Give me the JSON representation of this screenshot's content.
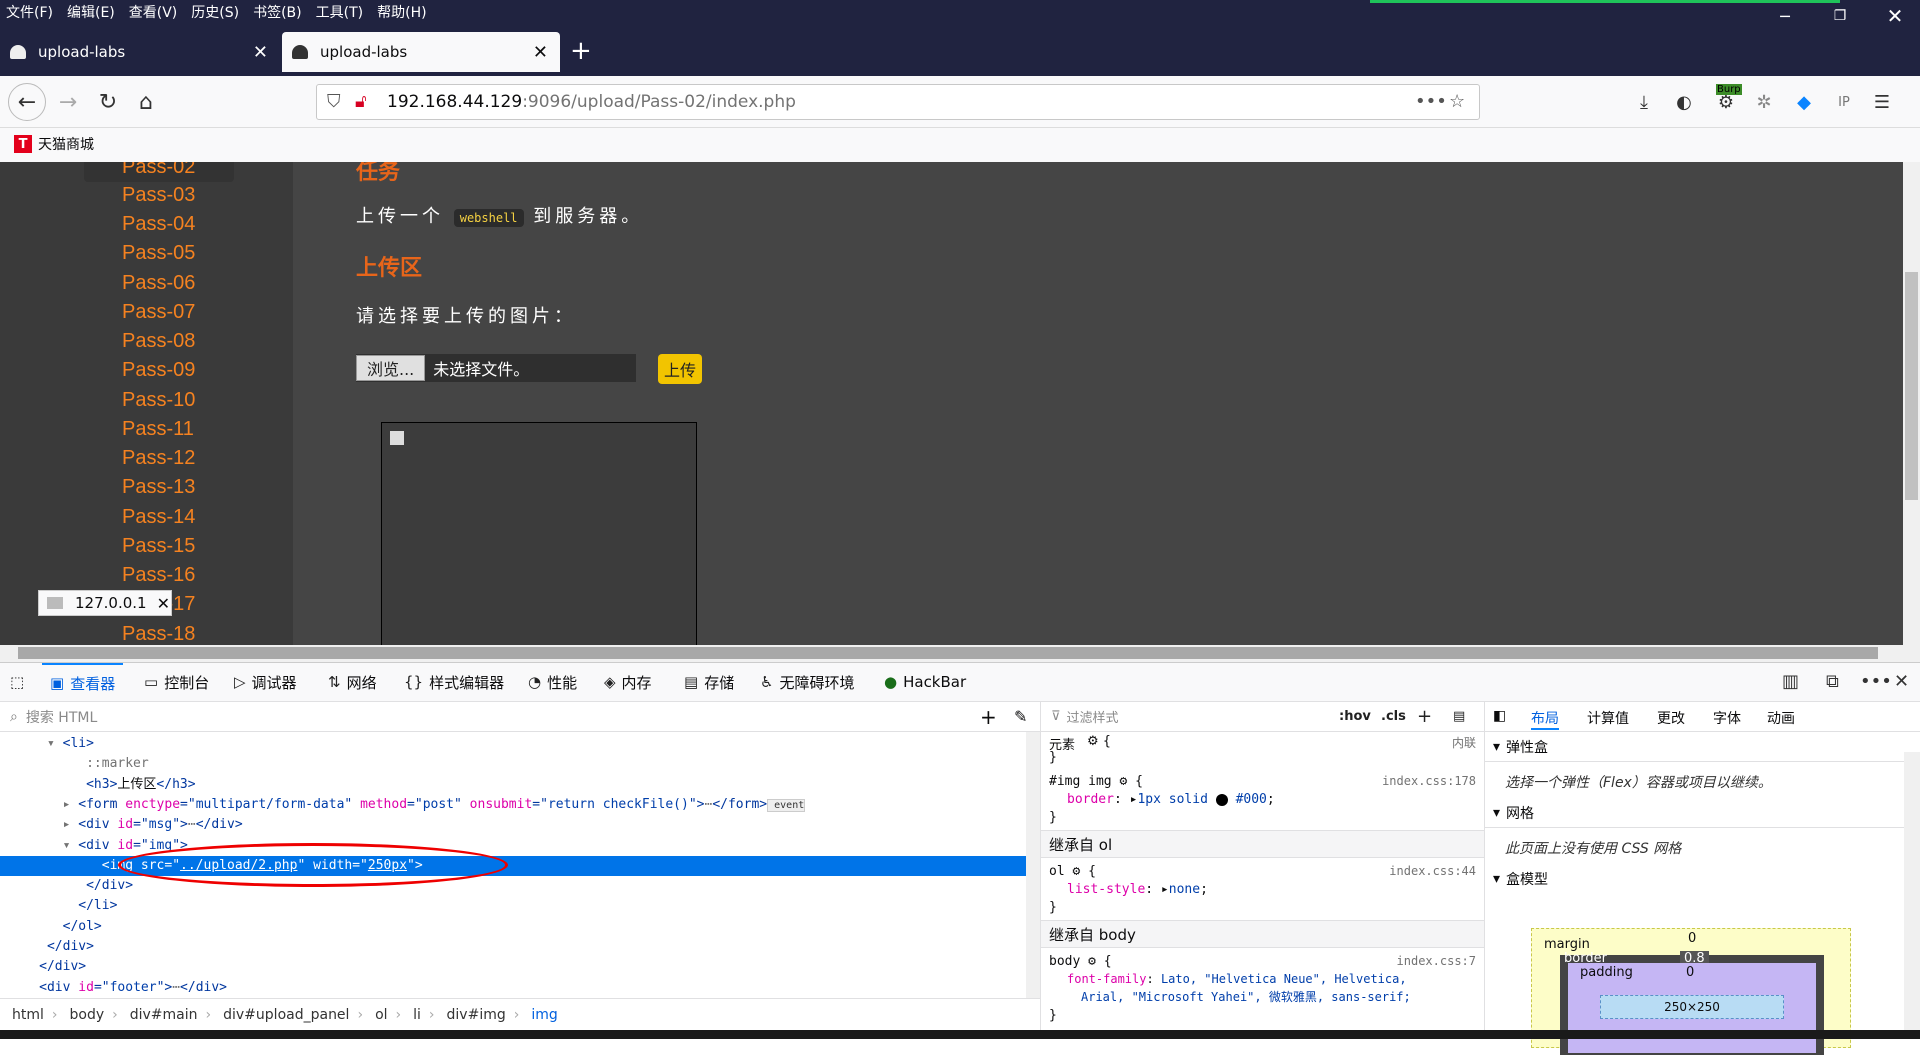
{
  "menubar": [
    "文件(F)",
    "编辑(E)",
    "查看(V)",
    "历史(S)",
    "书签(B)",
    "工具(T)",
    "帮助(H)"
  ],
  "tabs": [
    {
      "label": "upload-labs"
    },
    {
      "label": "upload-labs"
    }
  ],
  "url": {
    "host": "192.168.44.129",
    "rest": ":9096/upload/Pass-02/index.php"
  },
  "bookmarks": [
    {
      "label": "天猫商城",
      "icon": "T"
    }
  ],
  "burp_label": "Burp",
  "sidebar": {
    "items": [
      "Pass-02",
      "Pass-03",
      "Pass-04",
      "Pass-05",
      "Pass-06",
      "Pass-07",
      "Pass-08",
      "Pass-09",
      "Pass-10",
      "Pass-11",
      "Pass-12",
      "Pass-13",
      "Pass-14",
      "Pass-15",
      "Pass-16",
      "Pass-17",
      "Pass-18"
    ]
  },
  "main": {
    "task_heading": "任务",
    "task_pre": "上传一个",
    "task_code": "webshell",
    "task_post": "到服务器。",
    "upload_heading": "上传区",
    "choose_label": "请选择要上传的图片：",
    "browse_label": "浏览...",
    "no_file": "未选择文件。",
    "upload_button": "上传"
  },
  "tooltip": {
    "text": "127.0.0.1"
  },
  "devtools": {
    "tabs": [
      "查看器",
      "控制台",
      "调试器",
      "网络",
      "样式编辑器",
      "性能",
      "内存",
      "存储",
      "无障碍环境",
      "HackBar"
    ],
    "search_placeholder": "搜索 HTML",
    "tree": [
      {
        "indent": "        ",
        "parts": [
          [
            "tg",
            "<li>"
          ]
        ]
      },
      {
        "indent": "           ",
        "parts": [
          [
            "pu",
            "::marker"
          ]
        ]
      },
      {
        "indent": "           ",
        "parts": [
          [
            "tg",
            "<h3>"
          ],
          [
            "tx",
            "上传区"
          ],
          [
            "tg",
            "</h3>"
          ]
        ]
      },
      {
        "indent": "          ",
        "parts": [
          [
            "tg",
            "<form "
          ],
          [
            "at",
            "enctype"
          ],
          [
            "tg",
            "=\""
          ],
          [
            "av",
            "multipart/form-data"
          ],
          [
            "tg",
            "\" "
          ],
          [
            "at",
            "method"
          ],
          [
            "tg",
            "=\""
          ],
          [
            "av",
            "post"
          ],
          [
            "tg",
            "\" "
          ],
          [
            "at",
            "onsubmit"
          ],
          [
            "tg",
            "=\""
          ],
          [
            "av",
            "return checkFile()"
          ],
          [
            "tg",
            "\">"
          ],
          [
            "pu",
            "⋯"
          ],
          [
            "tg",
            "</form>"
          ],
          [
            "pu",
            " event"
          ]
        ]
      },
      {
        "indent": "          ",
        "parts": [
          [
            "tg",
            "<div "
          ],
          [
            "at",
            "id"
          ],
          [
            "tg",
            "=\""
          ],
          [
            "av",
            "msg"
          ],
          [
            "tg",
            "\">"
          ],
          [
            "pu",
            "⋯"
          ],
          [
            "tg",
            "</div>"
          ]
        ]
      },
      {
        "indent": "          ",
        "parts": [
          [
            "tg",
            "<div "
          ],
          [
            "at",
            "id"
          ],
          [
            "tg",
            "=\""
          ],
          [
            "av",
            "img"
          ],
          [
            "tg",
            "\">"
          ]
        ]
      },
      {
        "indent": "             ",
        "parts": [
          [
            "tg",
            "<img "
          ],
          [
            "at",
            "src"
          ],
          [
            "tg",
            "=\""
          ],
          [
            "av",
            "../upload/2.php"
          ],
          [
            "tg",
            "\" "
          ],
          [
            "at",
            "width"
          ],
          [
            "tg",
            "=\""
          ],
          [
            "av",
            "250px"
          ],
          [
            "tg",
            "\">"
          ]
        ]
      },
      {
        "indent": "           ",
        "parts": [
          [
            "tg",
            "</div>"
          ]
        ]
      },
      {
        "indent": "          ",
        "parts": [
          [
            "tg",
            "</li>"
          ]
        ]
      },
      {
        "indent": "        ",
        "parts": [
          [
            "tg",
            "</ol>"
          ]
        ]
      },
      {
        "indent": "      ",
        "parts": [
          [
            "tg",
            "</div>"
          ]
        ]
      },
      {
        "indent": "     ",
        "parts": [
          [
            "tg",
            "</div>"
          ]
        ]
      },
      {
        "indent": "     ",
        "parts": [
          [
            "tg",
            "<div "
          ],
          [
            "at",
            "id"
          ],
          [
            "tg",
            "=\""
          ],
          [
            "av",
            "footer"
          ],
          [
            "tg",
            "\">"
          ],
          [
            "pu",
            "⋯"
          ],
          [
            "tg",
            "</div>"
          ]
        ]
      }
    ],
    "breadcrumb": [
      "html",
      "body",
      "div#main",
      "div#upload_panel",
      "ol",
      "li",
      "div#img",
      "img"
    ],
    "rules": {
      "filter_placeholder": "过滤样式",
      "hov": ":hov",
      "cls": ".cls",
      "element_label": "元素",
      "inline_label": "内联",
      "r1_selector": "#img img",
      "r1_source": "index.css:178",
      "r1_prop": "border",
      "r1_val": "1px solid",
      "r1_color": "#000",
      "inh_ol": "继承自 ol",
      "r2_selector": "ol",
      "r2_source": "index.css:44",
      "r2_prop": "list-style",
      "r2_val": "none",
      "inh_body": "继承自 body",
      "r3_selector": "body",
      "r3_source": "index.css:7",
      "r3_prop": "font-family",
      "r3_val1": "Lato, \"Helvetica Neue\", Helvetica,",
      "r3_val2": "Arial, \"Microsoft Yahei\", 微软雅黑, sans-serif;"
    },
    "layout": {
      "tabs": [
        "布局",
        "计算值",
        "更改",
        "字体",
        "动画"
      ],
      "flex_title": "弹性盒",
      "flex_text": "选择一个弹性（Flex）容器或项目以继续。",
      "grid_title": "网格",
      "grid_text": "此页面上没有使用 CSS 网格",
      "box_title": "盒模型",
      "margin_label": "margin",
      "border_label": "border",
      "padding_label": "padding",
      "content_size": "250×250",
      "margin_val": "0",
      "border_val": "0.8",
      "padding_val": "0"
    }
  }
}
